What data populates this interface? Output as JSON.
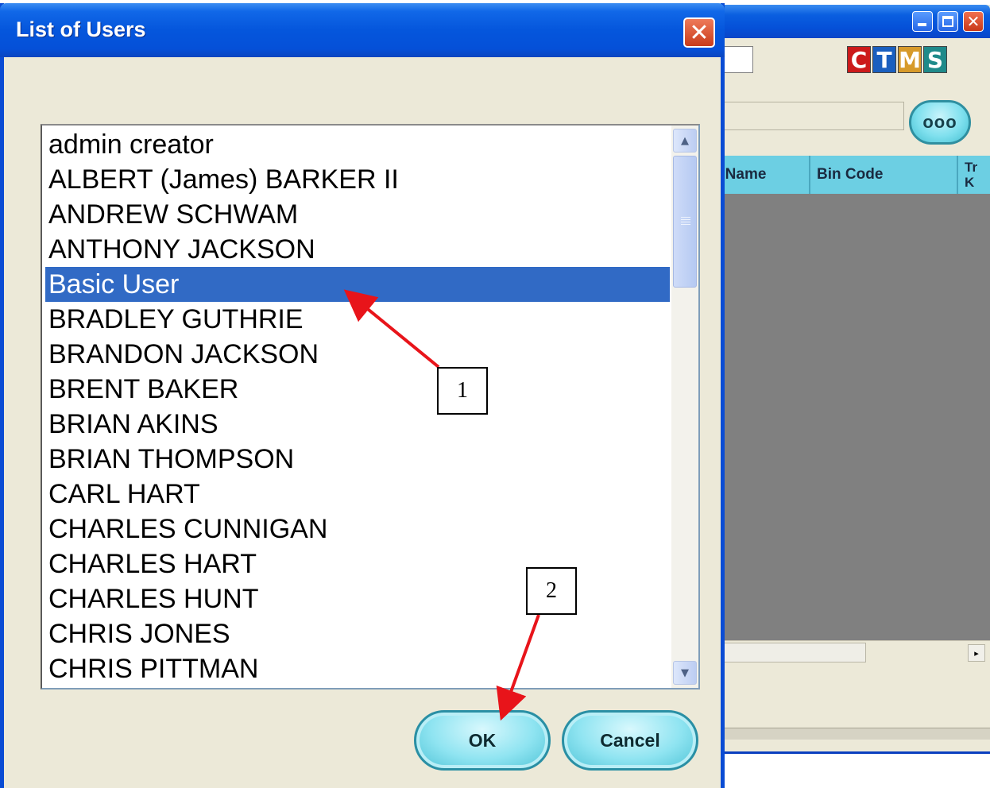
{
  "background_window": {
    "logo_letters": [
      {
        "letter": "C",
        "color": "#cc1a1a"
      },
      {
        "letter": "T",
        "color": "#1a5fbf"
      },
      {
        "letter": "M",
        "color": "#d79a2a"
      },
      {
        "letter": "S",
        "color": "#1f8a8a"
      }
    ],
    "browse_label": "ooo",
    "columns": [
      "r Name",
      "Bin Code",
      "Tr\nK"
    ],
    "scroll_right_glyph": "▸"
  },
  "dialog": {
    "title": "List of Users",
    "close_glyph": "✕",
    "users": [
      "admin creator",
      "ALBERT (James) BARKER II",
      "ANDREW SCHWAM",
      "ANTHONY JACKSON",
      "Basic User",
      "BRADLEY GUTHRIE",
      "BRANDON JACKSON",
      "BRENT BAKER",
      "BRIAN AKINS",
      "BRIAN THOMPSON",
      "CARL HART",
      "CHARLES CUNNIGAN",
      "CHARLES HART",
      "CHARLES HUNT",
      "CHRIS JONES",
      "CHRIS PITTMAN"
    ],
    "selected_user": "Basic User",
    "ok_label": "OK",
    "cancel_label": "Cancel"
  },
  "annotations": {
    "step1": "1",
    "step2": "2",
    "arrow_color": "#e8141a"
  }
}
